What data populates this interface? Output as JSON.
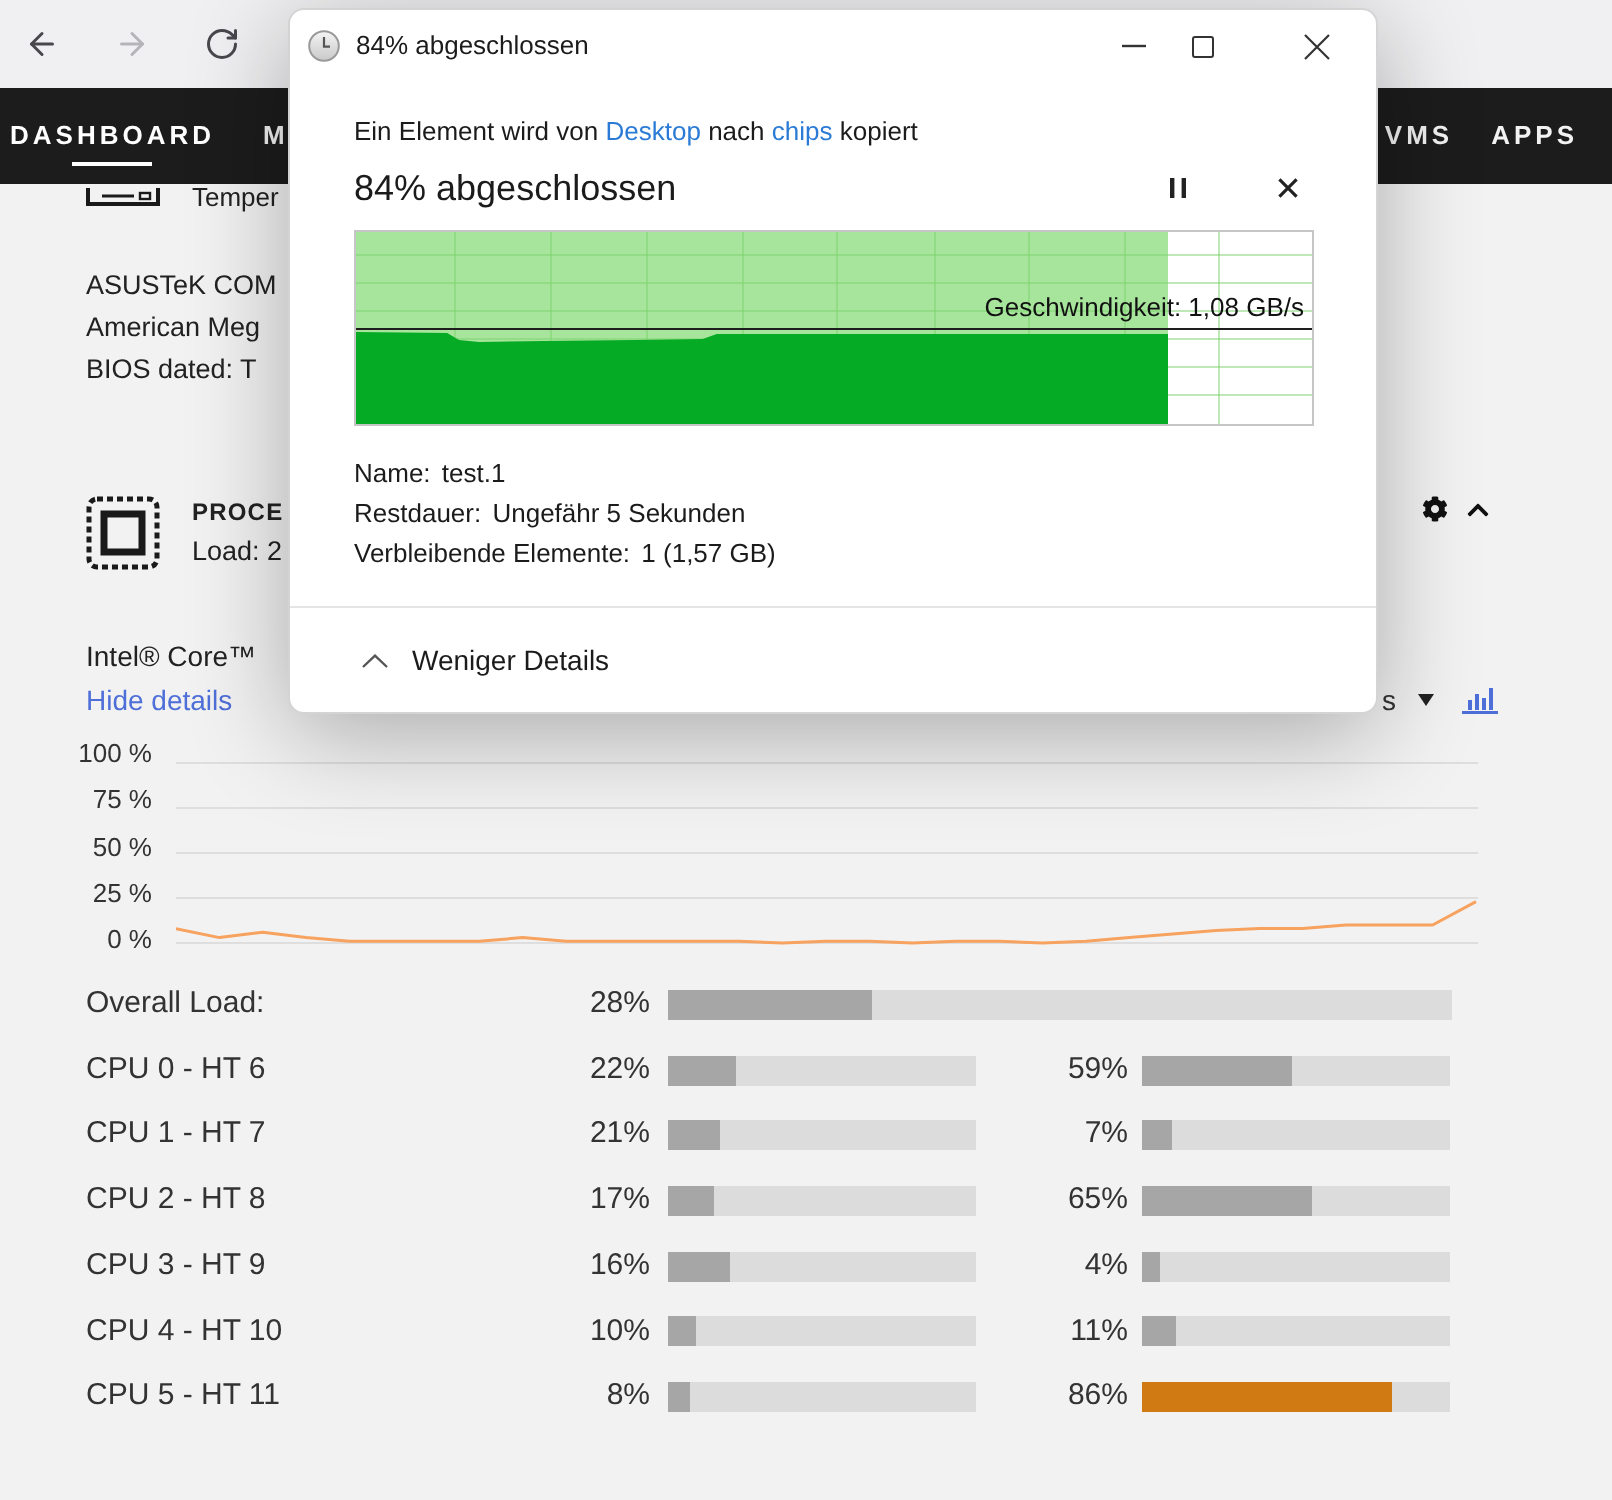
{
  "browser": {
    "buttons": [
      {
        "kind": "back",
        "disabled": false
      },
      {
        "kind": "forward",
        "disabled": true
      },
      {
        "kind": "reload",
        "disabled": false
      }
    ]
  },
  "nav": [
    {
      "label": "DASHBOARD",
      "selected": true
    },
    {
      "label": "M",
      "selected": false
    },
    {
      "label": "VMS",
      "selected": false
    },
    {
      "label": "APPS",
      "selected": false
    }
  ],
  "motherboard": {
    "temperature": "Temper",
    "lines": [
      "ASUSTeK COM",
      "American Meg",
      "BIOS dated: T"
    ]
  },
  "processor": {
    "title": "PROCE",
    "load": "Load: 2",
    "model": "Intel® Core™",
    "details_link": "Hide details",
    "view_label": "s",
    "chart_data": {
      "type": "line",
      "grid": true,
      "ylim": [
        0,
        100
      ],
      "yticks": [
        {
          "value": 0,
          "label": "0 %"
        },
        {
          "value": 25,
          "label": "25 %"
        },
        {
          "value": 50,
          "label": "50 %"
        },
        {
          "value": 75,
          "label": "75 %"
        },
        {
          "value": 100,
          "label": "100 %"
        }
      ],
      "series": [
        {
          "color": "#f7a25e",
          "values": [
            8,
            3,
            6,
            3,
            1,
            1,
            1,
            1,
            3,
            1,
            1,
            1,
            1,
            1,
            0,
            1,
            1,
            0,
            1,
            1,
            0,
            1,
            3,
            5,
            7,
            8,
            8,
            10,
            10,
            10,
            23
          ]
        }
      ]
    },
    "overall": {
      "label": "Overall Load:",
      "reading": "28%",
      "level": 0.26,
      "color": "#a6a6a6"
    },
    "cpus": [
      {
        "label": "CPU 0 - HT 6",
        "loads": [
          {
            "reading": "22%",
            "level": 0.22,
            "color": "#a6a6a6"
          },
          {
            "reading": "59%",
            "level": 0.49,
            "color": "#a6a6a6"
          }
        ]
      },
      {
        "label": "CPU 1 - HT 7",
        "loads": [
          {
            "reading": "21%",
            "level": 0.17,
            "color": "#a6a6a6"
          },
          {
            "reading": "7%",
            "level": 0.1,
            "color": "#a6a6a6"
          }
        ]
      },
      {
        "label": "CPU 2 - HT 8",
        "loads": [
          {
            "reading": "17%",
            "level": 0.15,
            "color": "#a6a6a6"
          },
          {
            "reading": "65%",
            "level": 0.55,
            "color": "#a6a6a6"
          }
        ]
      },
      {
        "label": "CPU 3 - HT 9",
        "loads": [
          {
            "reading": "16%",
            "level": 0.2,
            "color": "#a6a6a6"
          },
          {
            "reading": "4%",
            "level": 0.06,
            "color": "#a6a6a6"
          }
        ]
      },
      {
        "label": "CPU 4 - HT 10",
        "loads": [
          {
            "reading": "10%",
            "level": 0.09,
            "color": "#a6a6a6"
          },
          {
            "reading": "11%",
            "level": 0.11,
            "color": "#a6a6a6"
          }
        ]
      },
      {
        "label": "CPU 5 - HT 11",
        "loads": [
          {
            "reading": "8%",
            "level": 0.07,
            "color": "#a6a6a6"
          },
          {
            "reading": "86%",
            "level": 0.81,
            "color": "#d07a14"
          }
        ]
      }
    ]
  },
  "dialog": {
    "title": "84% abgeschlossen",
    "message": [
      {
        "kind": "text",
        "text": "Ein Element wird von"
      },
      {
        "kind": "link",
        "text": "Desktop"
      },
      {
        "kind": "text",
        "text": "nach"
      },
      {
        "kind": "link",
        "text": "chips"
      },
      {
        "kind": "text",
        "text": "kopiert"
      }
    ],
    "status": "84% abgeschlossen",
    "progress": {
      "level": 0.85
    },
    "speed": "Geschwindigkeit: 1,08 GB/s",
    "details": [
      {
        "label": "Name:",
        "value": "test.1"
      },
      {
        "label": "Restdauer:",
        "value": "Ungefähr 5 Sekunden"
      },
      {
        "label": "Verbleibende Elemente:",
        "value": "1 (1,57 GB)"
      }
    ],
    "toggle": "Weniger Details"
  }
}
